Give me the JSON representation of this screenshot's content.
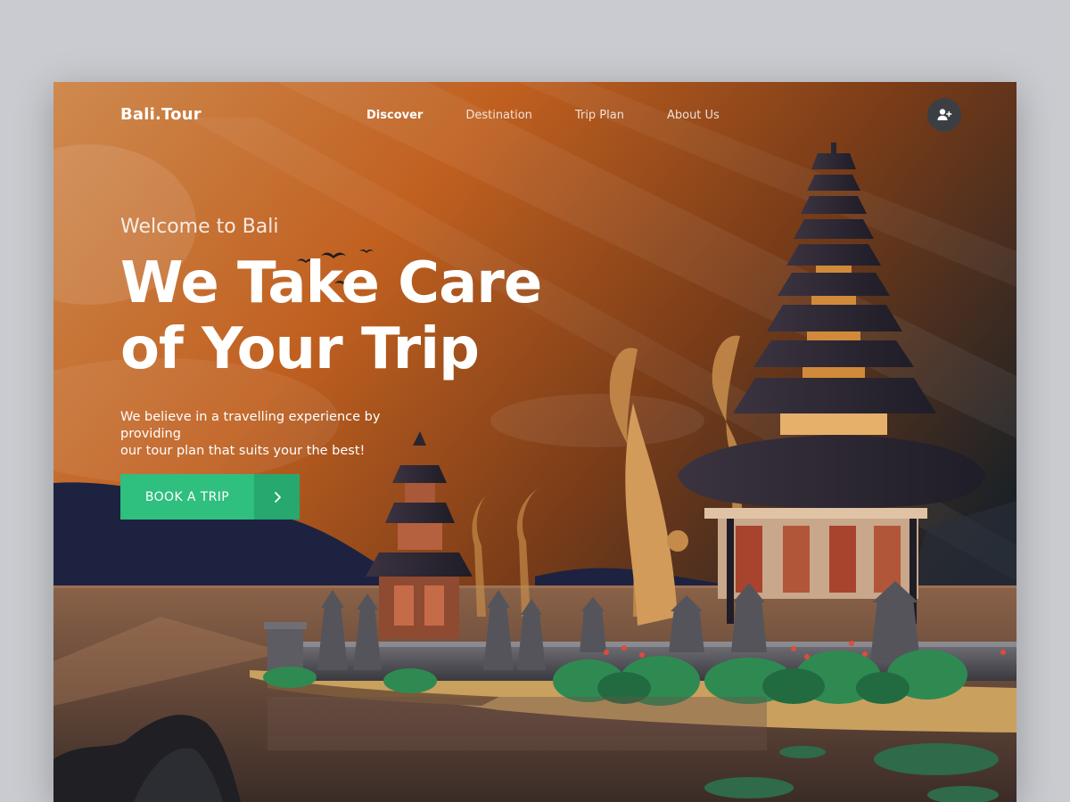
{
  "brand": {
    "logo": "Bali.Tour"
  },
  "nav": {
    "items": [
      {
        "label": "Discover",
        "active": true
      },
      {
        "label": "Destination",
        "active": false
      },
      {
        "label": "Trip Plan",
        "active": false
      },
      {
        "label": "About Us",
        "active": false
      }
    ],
    "user_icon": "user-plus-icon"
  },
  "hero": {
    "welcome": "Welcome to Bali",
    "headline_line1": "We Take Care",
    "headline_line2": "of Your Trip",
    "description_line1": "We believe in a travelling experience by providing",
    "description_line2": "our tour plan that suits your the best!",
    "cta_label": "BOOK A TRIP",
    "cta_icon": "chevron-right-icon"
  },
  "colors": {
    "accent": "#2fbf7f",
    "accent_dark": "#26a86e",
    "sky_orange": "#c0651f",
    "sky_dark": "#1e2328",
    "temple_roof": "#2a2630"
  }
}
